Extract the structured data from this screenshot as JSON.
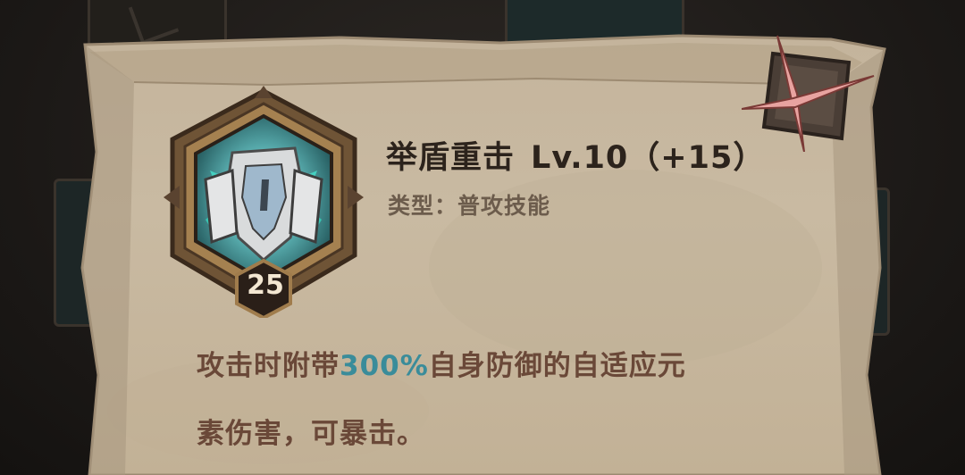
{
  "skill": {
    "name": "举盾重击",
    "level": "Lv.10（+15）",
    "type_label": "类型：",
    "type_value": "普攻技能",
    "badge_count": "25",
    "icon_name": "shield-bash-icon"
  },
  "description": {
    "before": "攻击时附带",
    "highlight": "300%",
    "after_line1": "自身防御的自适应元",
    "line2": "素伤害，可暴击。"
  },
  "colors": {
    "highlight": "#3a8c9a",
    "close_accent": "#e8a3a0"
  },
  "close_icon": "close-x-icon"
}
